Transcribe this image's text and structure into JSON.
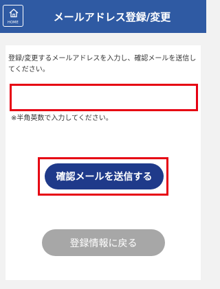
{
  "header": {
    "home_label": "HOME",
    "title": "メールアドレス登録/変更"
  },
  "form": {
    "description": "登録/変更するメールアドレスを入力し、確認メールを送信してください。",
    "email_value": "",
    "note": "※半角英数で入力してください。",
    "send_label": "確認メールを送信する",
    "back_label": "登録情報に戻る"
  },
  "colors": {
    "header_bg": "#2f5aa3",
    "highlight": "#e60012",
    "primary_button": "#1f3a8a",
    "secondary_button": "#a7a7a7"
  },
  "icons": {
    "home": "home-icon"
  }
}
